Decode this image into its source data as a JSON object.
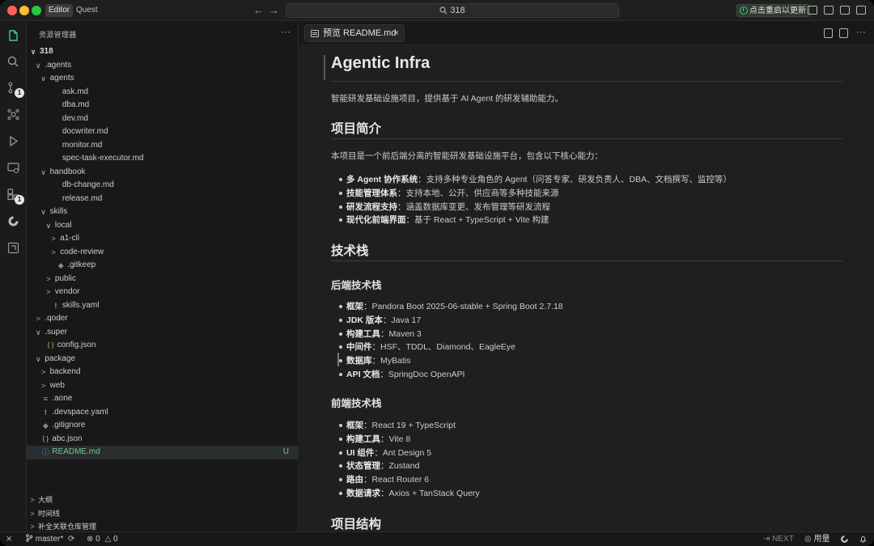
{
  "titlebar": {
    "mode_editor": "Editor",
    "mode_quest": "Quest",
    "search_text": "318",
    "restart_label": "点击重启以更新"
  },
  "activity": {
    "scm_badge": "1",
    "extensions_badge": "1"
  },
  "sidebar": {
    "title": "资源管理器",
    "more": "···",
    "tree": [
      {
        "label": "318",
        "depth": 0,
        "type": "root",
        "open": true
      },
      {
        "label": ".agents",
        "depth": 1,
        "type": "folder",
        "open": true
      },
      {
        "label": "agents",
        "depth": 2,
        "type": "folder",
        "open": true
      },
      {
        "label": "ask.md",
        "depth": 3,
        "type": "md"
      },
      {
        "label": "dba.md",
        "depth": 3,
        "type": "md"
      },
      {
        "label": "dev.md",
        "depth": 3,
        "type": "md"
      },
      {
        "label": "docwriter.md",
        "depth": 3,
        "type": "md"
      },
      {
        "label": "monitor.md",
        "depth": 3,
        "type": "md"
      },
      {
        "label": "spec-task-executor.md",
        "depth": 3,
        "type": "md"
      },
      {
        "label": "handbook",
        "depth": 2,
        "type": "folder",
        "open": true
      },
      {
        "label": "db-change.md",
        "depth": 3,
        "type": "md"
      },
      {
        "label": "release.md",
        "depth": 3,
        "type": "md"
      },
      {
        "label": "skills",
        "depth": 2,
        "type": "folder",
        "open": true
      },
      {
        "label": "local",
        "depth": 3,
        "type": "folder",
        "open": true
      },
      {
        "label": "a1-cli",
        "depth": 4,
        "type": "folder",
        "open": false
      },
      {
        "label": "code-review",
        "depth": 4,
        "type": "folder",
        "open": false
      },
      {
        "label": ".gitkeep",
        "depth": 4,
        "type": "git"
      },
      {
        "label": "public",
        "depth": 3,
        "type": "folder",
        "open": false
      },
      {
        "label": "vendor",
        "depth": 3,
        "type": "folder",
        "open": false
      },
      {
        "label": "skills.yaml",
        "depth": 3,
        "type": "yaml"
      },
      {
        "label": ".qoder",
        "depth": 1,
        "type": "folder",
        "open": false
      },
      {
        "label": ".super",
        "depth": 1,
        "type": "folder",
        "open": true
      },
      {
        "label": "config.json",
        "depth": 2,
        "type": "json"
      },
      {
        "label": "package",
        "depth": 1,
        "type": "folder",
        "open": true
      },
      {
        "label": "backend",
        "depth": 2,
        "type": "folder",
        "open": false
      },
      {
        "label": "web",
        "depth": 2,
        "type": "folder",
        "open": false
      },
      {
        "label": ".aone",
        "depth": 1,
        "type": "aone"
      },
      {
        "label": ".devspace.yaml",
        "depth": 1,
        "type": "yaml"
      },
      {
        "label": ".gitignore",
        "depth": 1,
        "type": "git"
      },
      {
        "label": "abc.json",
        "depth": 1,
        "type": "json"
      },
      {
        "label": "README.md",
        "depth": 1,
        "type": "info",
        "selected": true,
        "status": "U"
      }
    ],
    "bottom_sections": [
      "大纲",
      "时间线",
      "补全关联仓库管理"
    ]
  },
  "editor": {
    "tab_label": "预览 README.md",
    "tab_close": "×"
  },
  "doc": {
    "title": "Agentic Infra",
    "intro": "智能研发基础设施项目，提供基于 AI Agent 的研发辅助能力。",
    "overview_heading": "项目简介",
    "overview_text": "本项目是一个前后端分离的智能研发基础设施平台，包含以下核心能力：",
    "capabilities": [
      {
        "key": "多 Agent 协作系统",
        "text": "：支持多种专业角色的 Agent（问答专家、研发负责人、DBA、文档撰写、监控等）"
      },
      {
        "key": "技能管理体系",
        "text": "：支持本地、公开、供应商等多种技能来源"
      },
      {
        "key": "研发流程支持",
        "text": "：涵盖数据库变更、发布管理等研发流程"
      },
      {
        "key": "现代化前端界面",
        "text": "：基于 React + TypeScript + Vite 构建"
      }
    ],
    "stack_heading": "技术栈",
    "backend_heading": "后端技术栈",
    "backend": [
      {
        "key": "框架",
        "text": "：Pandora Boot 2025-06-stable + Spring Boot 2.7.18"
      },
      {
        "key": "JDK 版本",
        "text": "：Java 17"
      },
      {
        "key": "构建工具",
        "text": "：Maven 3"
      },
      {
        "key": "中间件",
        "text": "：HSF、TDDL、Diamond、EagleEye"
      },
      {
        "key": "数据库",
        "text": "：MyBatis"
      },
      {
        "key": "API 文档",
        "text": "：SpringDoc OpenAPI"
      }
    ],
    "frontend_heading": "前端技术栈",
    "frontend": [
      {
        "key": "框架",
        "text": "：React 19 + TypeScript"
      },
      {
        "key": "构建工具",
        "text": "：Vite 8"
      },
      {
        "key": "UI 组件",
        "text": "：Ant Design 5"
      },
      {
        "key": "状态管理",
        "text": "：Zustand"
      },
      {
        "key": "路由",
        "text": "：React Router 6"
      },
      {
        "key": "数据请求",
        "text": "：Axios + TanStack Query"
      }
    ],
    "structure_heading": "项目结构"
  },
  "statusbar": {
    "remote": "⨯",
    "branch": "master*",
    "errors": "0",
    "warnings": "0",
    "next": "NEXT",
    "usage": "用量"
  }
}
